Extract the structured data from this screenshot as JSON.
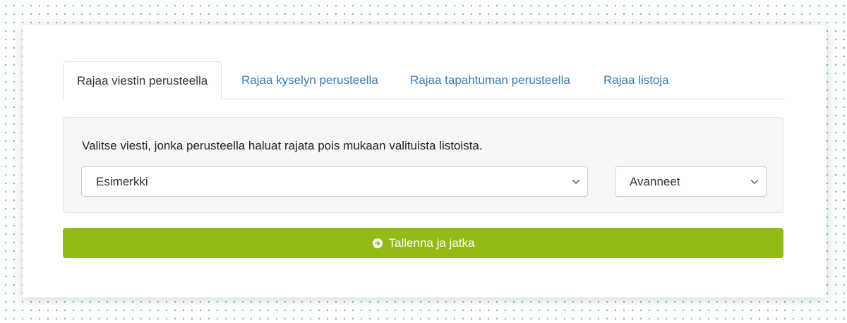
{
  "tabs": [
    {
      "label": "Rajaa viestin perusteella",
      "active": true
    },
    {
      "label": "Rajaa kyselyn perusteella",
      "active": false
    },
    {
      "label": "Rajaa tapahtuman perusteella",
      "active": false
    },
    {
      "label": "Rajaa listoja",
      "active": false
    }
  ],
  "panel": {
    "instruction": "Valitse viesti, jonka perusteella haluat rajata pois mukaan valituista listoista.",
    "message_select": {
      "value": "Esimerkki",
      "icon": "chevron-down-icon"
    },
    "status_select": {
      "value": "Avanneet",
      "icon": "chevron-down-icon"
    }
  },
  "save_button": {
    "label": "Tallenna ja jatka",
    "icon": "arrow-circle-right-icon"
  },
  "colors": {
    "accent": "#92bb16",
    "link": "#3b7ab4",
    "dots": "#6fc2b4"
  }
}
